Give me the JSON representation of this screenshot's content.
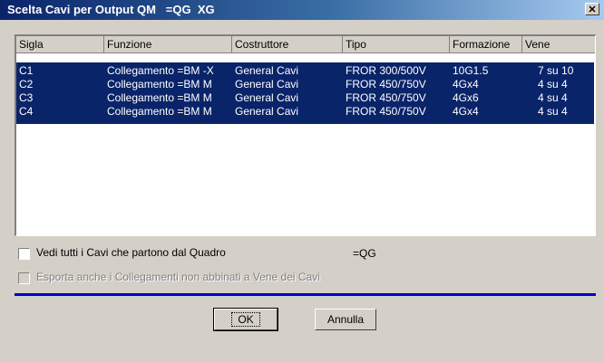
{
  "window": {
    "title": "Scelta Cavi per Output QM   =QG  XG",
    "close_glyph": "✕"
  },
  "columns": [
    "Sigla",
    "Funzione",
    "Costruttore",
    "Tipo",
    "Formazione",
    "Vene"
  ],
  "rows": [
    [
      "C1",
      "Collegamento =BM -X",
      "General Cavi",
      "FROR 300/500V",
      "10G1.5",
      "7 su 10"
    ],
    [
      "C2",
      "Collegamento =BM M",
      "General Cavi",
      "FROR 450/750V",
      "4Gx4",
      "4 su 4"
    ],
    [
      "C3",
      "Collegamento =BM M",
      "General Cavi",
      "FROR 450/750V",
      "4Gx6",
      "4 su 4"
    ],
    [
      "C4",
      "Collegamento =BM M",
      "General Cavi",
      "FROR 450/750V",
      "4Gx4",
      "4 su 4"
    ]
  ],
  "options": {
    "show_all_label": "Vedi tutti i Cavi che partono dal Quadro",
    "show_all_checked": false,
    "quadro_value": "=QG",
    "export_label": "Esporta anche i Collegamenti non abbinati a Vene dei Cavi",
    "export_checked": false,
    "export_enabled": false
  },
  "buttons": {
    "ok": "OK",
    "cancel": "Annulla"
  },
  "colors": {
    "selection": "#0a246a",
    "separator": "#0000cc"
  }
}
